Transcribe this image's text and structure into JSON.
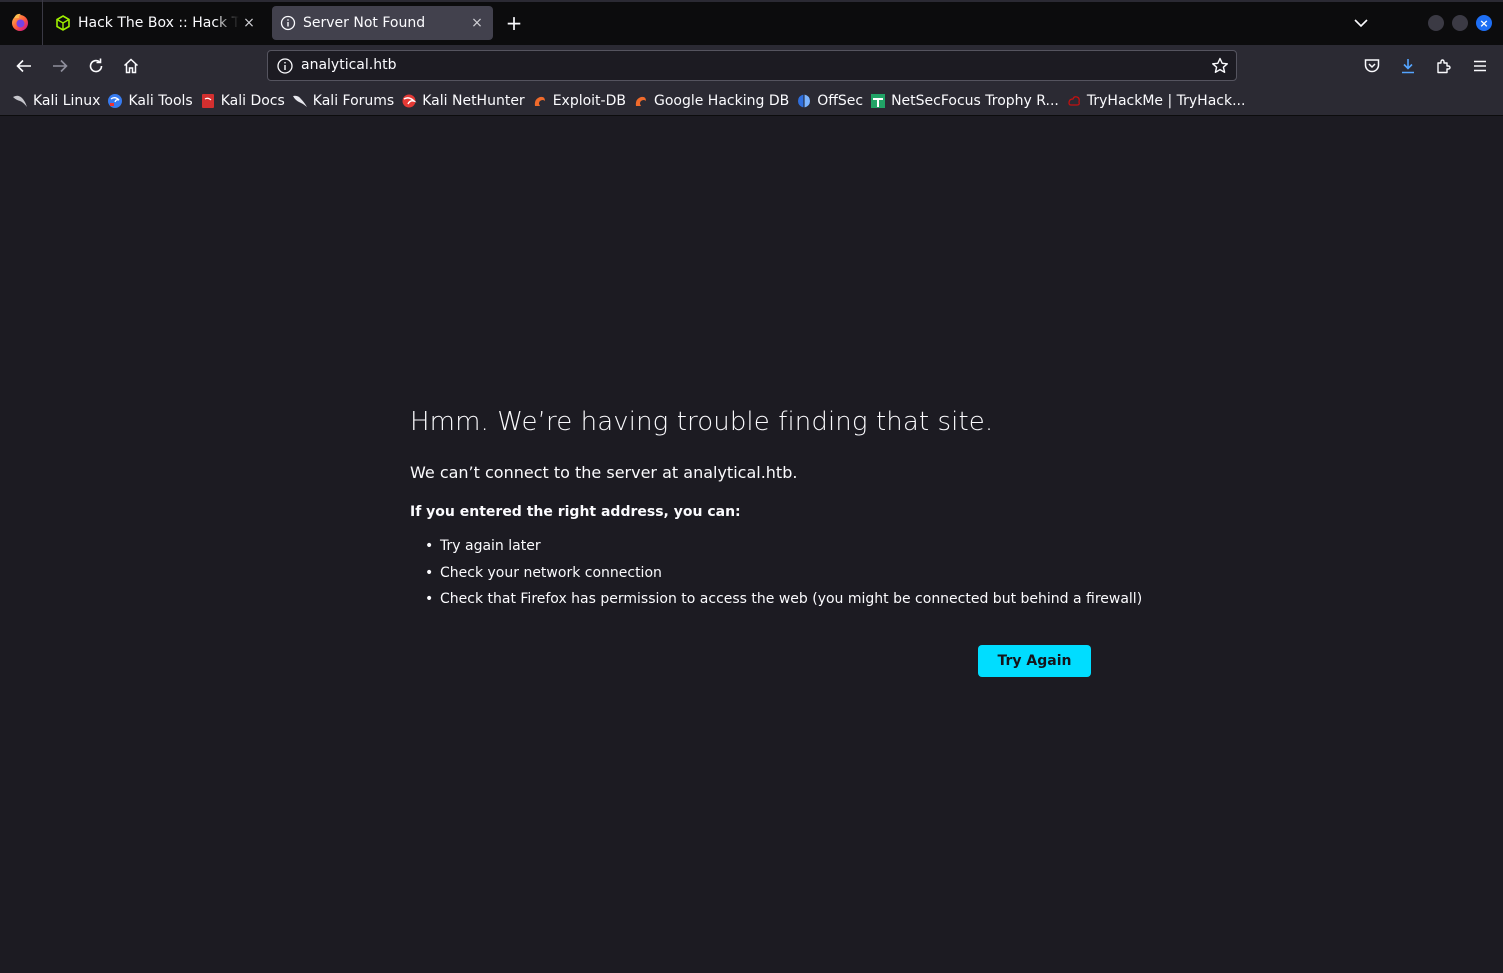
{
  "tabs": [
    {
      "title": "Hack The Box :: Hack The Box",
      "active": false
    },
    {
      "title": "Server Not Found",
      "active": true
    }
  ],
  "icons": {
    "firefox": "firefox-logo-icon",
    "htb": "hackthebox-cube-icon",
    "info": "info-icon",
    "close": "×",
    "new_tab": "+",
    "window_close": "×"
  },
  "urlbar": {
    "url": "analytical.htb"
  },
  "bookmarks": [
    {
      "label": "Kali Linux",
      "icon": "kali-dragon-icon"
    },
    {
      "label": "Kali Tools",
      "icon": "kali-tools-icon"
    },
    {
      "label": "Kali Docs",
      "icon": "kali-docs-icon"
    },
    {
      "label": "Kali Forums",
      "icon": "kali-forums-icon"
    },
    {
      "label": "Kali NetHunter",
      "icon": "nethunter-icon"
    },
    {
      "label": "Exploit-DB",
      "icon": "exploit-db-icon"
    },
    {
      "label": "Google Hacking DB",
      "icon": "ghdb-icon"
    },
    {
      "label": "OffSec",
      "icon": "offsec-icon"
    },
    {
      "label": "NetSecFocus Trophy R...",
      "icon": "netsecfocus-icon"
    },
    {
      "label": "TryHackMe | TryHack...",
      "icon": "tryhackme-icon"
    }
  ],
  "error": {
    "title": "Hmm. We’re having trouble finding that site.",
    "description": "We can’t connect to the server at analytical.htb.",
    "subtitle": "If you entered the right address, you can:",
    "items": [
      "Try again later",
      "Check your network connection",
      "Check that Firefox has permission to access the web (you might be connected but behind a firewall)"
    ],
    "button": "Try Again"
  },
  "colors": {
    "accent": "#00ddff",
    "page_bg": "#1c1b22",
    "toolbar_bg": "#2b2a33",
    "downloads_accent": "#54a4ff"
  }
}
